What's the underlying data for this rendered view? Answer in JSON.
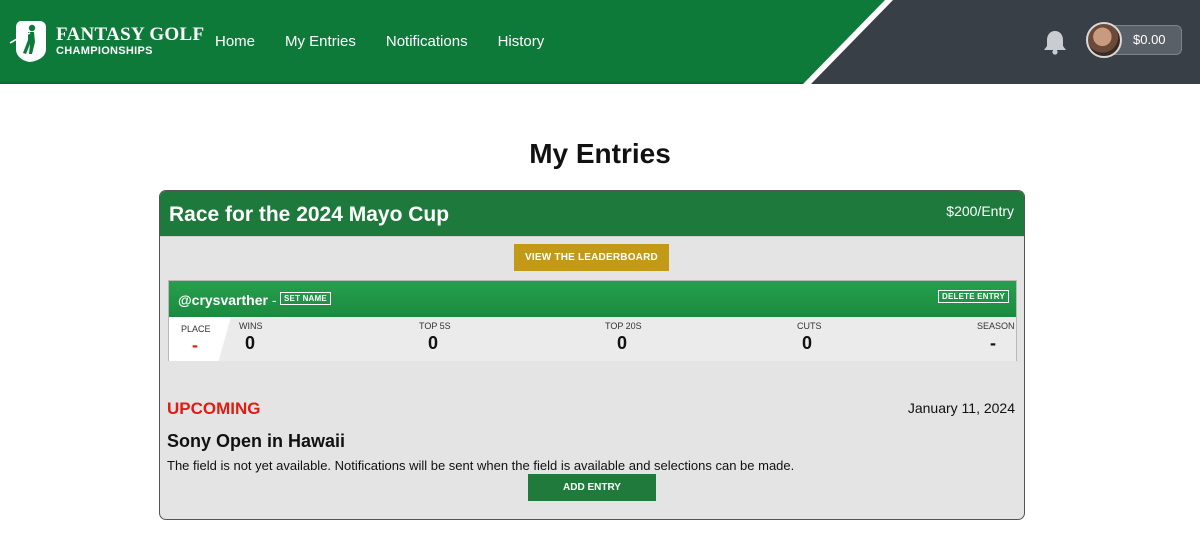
{
  "header": {
    "logo_line1": "FANTASY GOLF",
    "logo_line2": "CHAMPIONSHIPS",
    "nav": [
      "Home",
      "My Entries",
      "Notifications",
      "History"
    ],
    "balance": "$0.00",
    "icons": {
      "bell": "bell-icon",
      "logo": "golfer-icon"
    }
  },
  "page": {
    "title": "My Entries"
  },
  "contest": {
    "title": "Race for the 2024 Mayo Cup",
    "price": "$200/Entry",
    "leaderboard_button": "VIEW THE LEADERBOARD",
    "entry": {
      "username": "@crysvarther",
      "separator": "-",
      "set_name_button": "SET NAME",
      "delete_button": "DELETE ENTRY",
      "stats": [
        {
          "label": "PLACE",
          "value": "-"
        },
        {
          "label": "WINS",
          "value": "0"
        },
        {
          "label": "TOP 5S",
          "value": "0"
        },
        {
          "label": "TOP 20S",
          "value": "0"
        },
        {
          "label": "CUTS",
          "value": "0"
        },
        {
          "label": "SEASON",
          "value": "-"
        }
      ]
    },
    "event": {
      "status": "UPCOMING",
      "date": "January 11, 2024",
      "name": "Sony Open in Hawaii",
      "note": "The field is not yet available. Notifications will be sent when the field is available and selections can be made.",
      "add_button": "ADD ENTRY"
    }
  },
  "colors": {
    "brand_green": "#0e7a3a",
    "header_dark": "#393f47",
    "gold": "#c39a17",
    "upcoming_red": "#e31b12"
  }
}
